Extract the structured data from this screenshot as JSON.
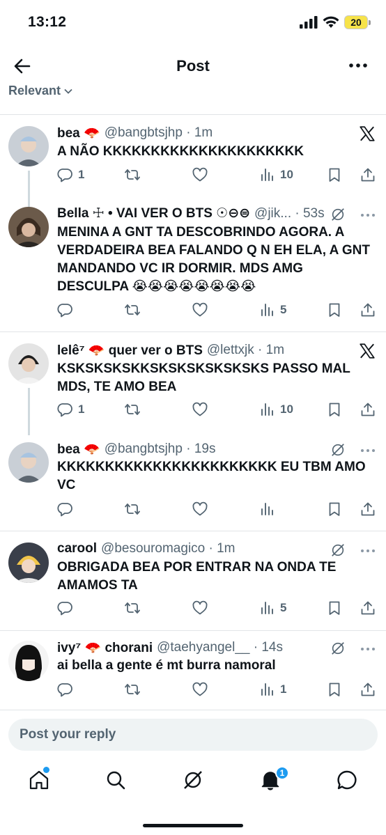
{
  "status": {
    "time": "13:12",
    "battery": "20"
  },
  "header": {
    "title": "Post"
  },
  "sort": {
    "label": "Relevant"
  },
  "tweets": [
    {
      "name": "bea 🪭",
      "handle": "@bangbtsjhp · 1m",
      "text": "A NÃO KKKKKKKKKKKKKKKKKKKKK",
      "replies": "1",
      "reposts": "",
      "likes": "",
      "views": "10"
    },
    {
      "name": "Bella ☩ • VAI VER O BTS ☉⊖⊜",
      "handle": "@jik... · 53s",
      "text": "MENINA A GNT TA DESCOBRINDO AGORA. A VERDADEIRA BEA FALANDO Q N EH ELA, A GNT MANDANDO VC IR DORMIR. MDS AMG DESCULPA 😭😭😭😭😭😭😭😭",
      "replies": "",
      "reposts": "",
      "likes": "",
      "views": "5"
    },
    {
      "name": "lelê⁷ 🪭 quer ver o BTS",
      "handle": "@lettxjk · 1m",
      "text": "KSKSKSKSKKSKSKSKSKSKSKS PASSO MAL MDS, TE AMO BEA",
      "replies": "1",
      "reposts": "",
      "likes": "",
      "views": "10"
    },
    {
      "name": "bea 🪭",
      "handle": "@bangbtsjhp · 19s",
      "text": "KKKKKKKKKKKKKKKKKKKKKKK EU TBM AMO VC",
      "replies": "",
      "reposts": "",
      "likes": "",
      "views": ""
    },
    {
      "name": "carool",
      "handle": "@besouromagico · 1m",
      "text": "OBRIGADA BEA POR ENTRAR NA ONDA TE AMAMOS TA",
      "replies": "",
      "reposts": "",
      "likes": "",
      "views": "5"
    },
    {
      "name": "ivy⁷ 🪭 chorani",
      "handle": "@taehyangel__ · 14s",
      "text": "ai bella a gente é mt burra namoral",
      "replies": "",
      "reposts": "",
      "likes": "",
      "views": "1"
    }
  ],
  "reply": {
    "placeholder": "Post your reply"
  },
  "tabs": {
    "notifications_badge": "1"
  },
  "colors": {
    "accent": "#1d9bf0",
    "muted": "#536471",
    "text": "#0f1419"
  }
}
